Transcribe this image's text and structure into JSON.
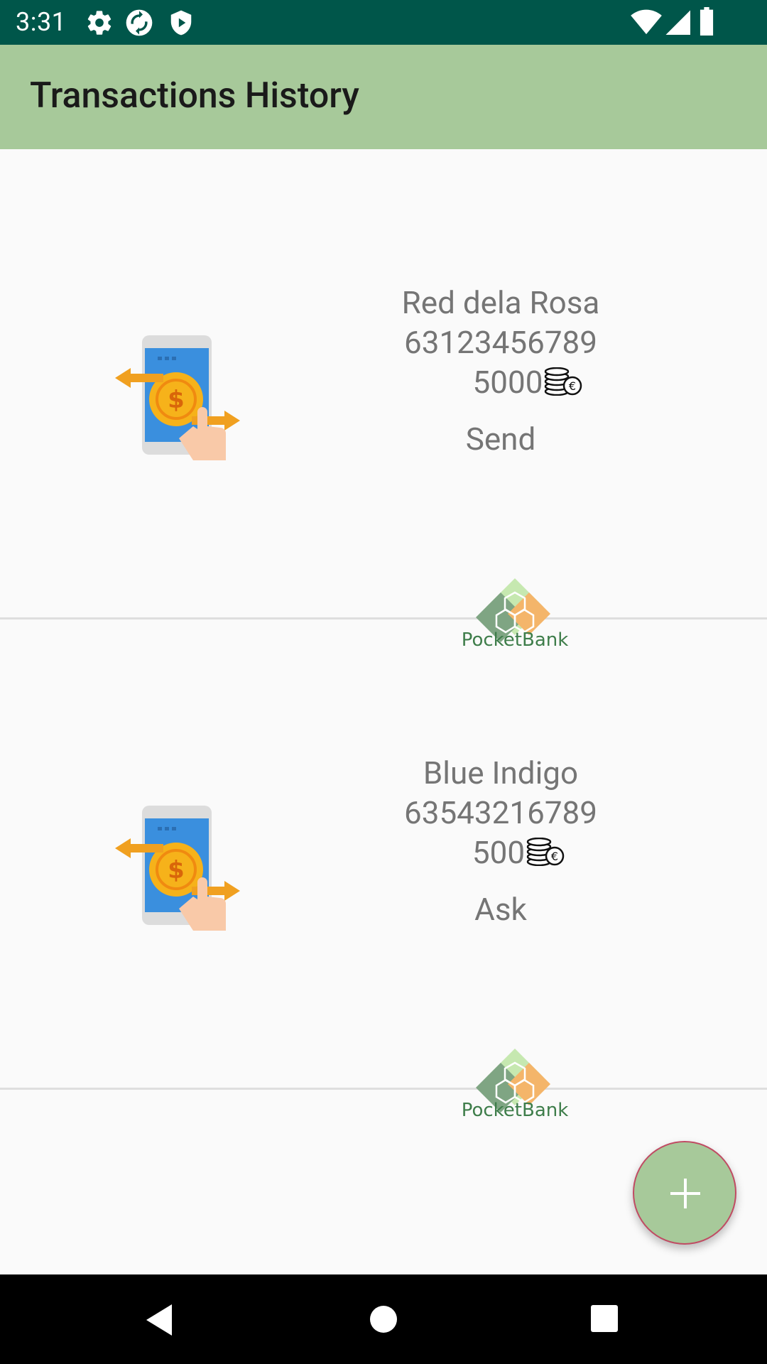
{
  "status_bar": {
    "time": "3:31",
    "icons": [
      "gear-icon",
      "sync-icon",
      "shield-icon",
      "wifi-icon",
      "signal-icon",
      "battery-icon"
    ]
  },
  "app_bar": {
    "title": "Transactions History",
    "color": "#a7c99a"
  },
  "transactions": [
    {
      "name": "Red dela Rosa",
      "number": "63123456789",
      "amount": "5000",
      "type": "Send",
      "logo_text": "PocketBank"
    },
    {
      "name": "Blue Indigo",
      "number": "63543216789",
      "amount": "500",
      "type": "Ask",
      "logo_text": "PocketBank"
    }
  ],
  "fab": {
    "icon": "plus-icon"
  },
  "nav_bar": {
    "buttons": [
      "back-icon",
      "home-icon",
      "recents-icon"
    ]
  }
}
